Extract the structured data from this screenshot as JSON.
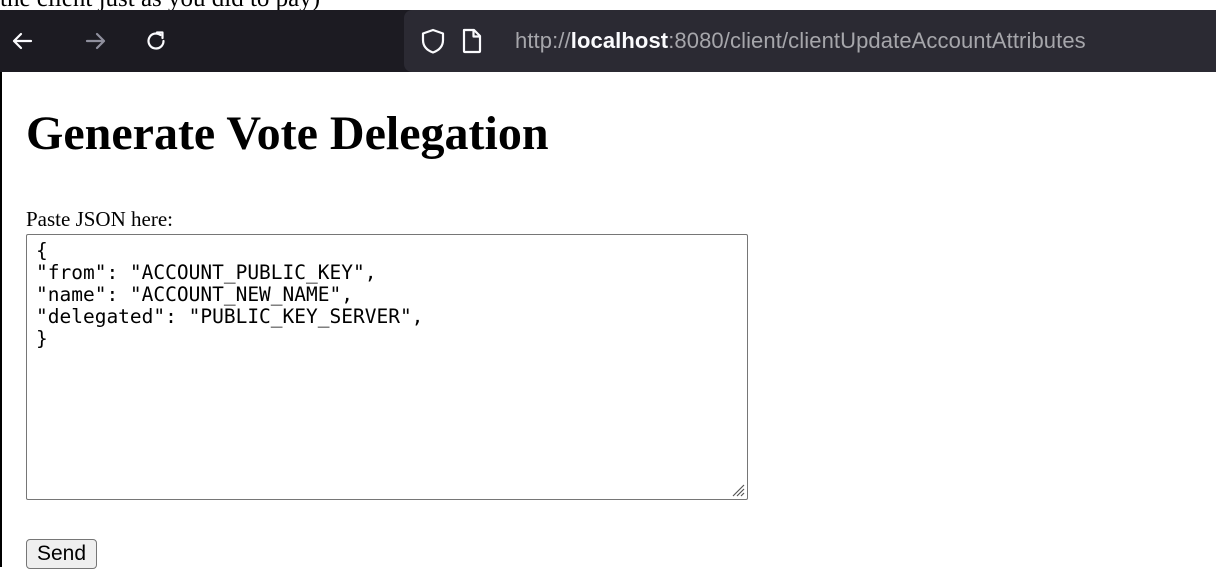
{
  "cut_text": "the client just as you did to pay)",
  "browser": {
    "url_prefix": "http://",
    "url_host": "localhost",
    "url_path": ":8080/client/clientUpdateAccountAttributes",
    "icons": [
      "back-arrow-icon",
      "forward-arrow-icon",
      "reload-icon",
      "shield-icon",
      "page-icon"
    ]
  },
  "page": {
    "title": "Generate Vote Delegation",
    "label": "Paste JSON here:",
    "textarea_value": "{\n\"from\": \"ACCOUNT_PUBLIC_KEY\",\n\"name\": \"ACCOUNT_NEW_NAME\",\n\"delegated\": \"PUBLIC_KEY_SERVER\",\n}",
    "send_label": "Send"
  },
  "colors": {
    "toolbar_bg": "#1c1b22",
    "urlbar_bg": "#2b2a33",
    "url_dim": "#a6a6ab",
    "url_host": "#fbfbfe"
  }
}
